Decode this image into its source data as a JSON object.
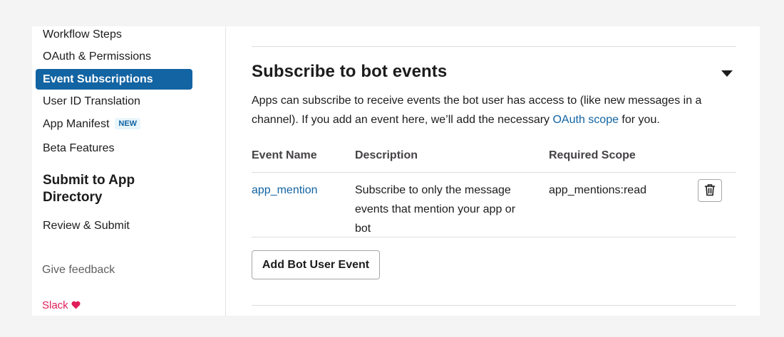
{
  "sidebar": {
    "items": [
      {
        "label": "Workflow Steps"
      },
      {
        "label": "OAuth & Permissions"
      },
      {
        "label": "Event Subscriptions",
        "active": true
      },
      {
        "label": "User ID Translation"
      },
      {
        "label": "App Manifest",
        "badge": "NEW"
      },
      {
        "label": "Beta Features"
      }
    ],
    "heading": "Submit to App Directory",
    "review_label": "Review & Submit",
    "feedback_label": "Give feedback",
    "slack_label": "Slack",
    "heart_icon": "heart-icon"
  },
  "section": {
    "title": "Subscribe to bot events",
    "description_before": "Apps can subscribe to receive events the bot user has access to (like new messages in a channel). If you add an event here, we’ll add the necessary ",
    "description_link": "OAuth scope",
    "description_after": " for you."
  },
  "table": {
    "headers": [
      "Event Name",
      "Description",
      "Required Scope"
    ],
    "rows": [
      {
        "event": "app_mention",
        "description": "Subscribe to only the message events that mention your app or bot",
        "scope": "app_mentions:read"
      }
    ]
  },
  "add_button_label": "Add Bot User Event",
  "colors": {
    "accent": "#1264a3",
    "slack_pink": "#e01e5a"
  }
}
